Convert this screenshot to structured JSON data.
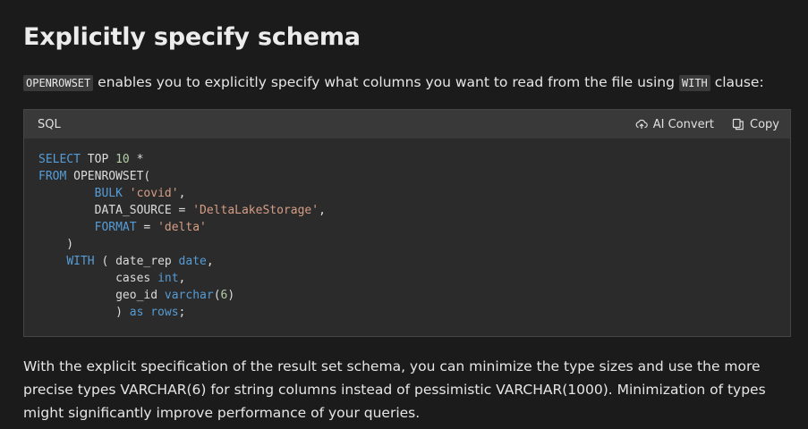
{
  "heading": "Explicitly specify schema",
  "intro": {
    "code1": "OPENROWSET",
    "text": " enables you to explicitly specify what columns you want to read from the file using ",
    "code2": "WITH",
    "tail": " clause:"
  },
  "codeblock": {
    "language": "SQL",
    "ai_convert_label": "AI Convert",
    "copy_label": "Copy",
    "lines": [
      [
        {
          "t": "SELECT",
          "c": "kw"
        },
        {
          "t": " TOP ",
          "c": ""
        },
        {
          "t": "10",
          "c": "num"
        },
        {
          "t": " *",
          "c": ""
        }
      ],
      [
        {
          "t": "FROM",
          "c": "kw"
        },
        {
          "t": " OPENROWSET(",
          "c": ""
        }
      ],
      [
        {
          "t": "        ",
          "c": ""
        },
        {
          "t": "BULK",
          "c": "kw"
        },
        {
          "t": " ",
          "c": ""
        },
        {
          "t": "'covid'",
          "c": "str"
        },
        {
          "t": ",",
          "c": ""
        }
      ],
      [
        {
          "t": "        DATA_SOURCE = ",
          "c": ""
        },
        {
          "t": "'DeltaLakeStorage'",
          "c": "str"
        },
        {
          "t": ",",
          "c": ""
        }
      ],
      [
        {
          "t": "        ",
          "c": ""
        },
        {
          "t": "FORMAT",
          "c": "kw"
        },
        {
          "t": " = ",
          "c": ""
        },
        {
          "t": "'delta'",
          "c": "str"
        }
      ],
      [
        {
          "t": "    )",
          "c": ""
        }
      ],
      [
        {
          "t": "    ",
          "c": ""
        },
        {
          "t": "WITH",
          "c": "kw"
        },
        {
          "t": " ( date_rep ",
          "c": ""
        },
        {
          "t": "date",
          "c": "kw"
        },
        {
          "t": ",",
          "c": ""
        }
      ],
      [
        {
          "t": "           cases ",
          "c": ""
        },
        {
          "t": "int",
          "c": "kw"
        },
        {
          "t": ",",
          "c": ""
        }
      ],
      [
        {
          "t": "           geo_id ",
          "c": ""
        },
        {
          "t": "varchar",
          "c": "kw"
        },
        {
          "t": "(",
          "c": ""
        },
        {
          "t": "6",
          "c": "num"
        },
        {
          "t": ")",
          "c": ""
        }
      ],
      [
        {
          "t": "           ) ",
          "c": ""
        },
        {
          "t": "as",
          "c": "kw"
        },
        {
          "t": " ",
          "c": ""
        },
        {
          "t": "rows",
          "c": "kw"
        },
        {
          "t": ";",
          "c": ""
        }
      ]
    ]
  },
  "body": "With the explicit specification of the result set schema, you can minimize the type sizes and use the more precise types VARCHAR(6) for string columns instead of pessimistic VARCHAR(1000). Minimization of types might significantly improve performance of your queries."
}
